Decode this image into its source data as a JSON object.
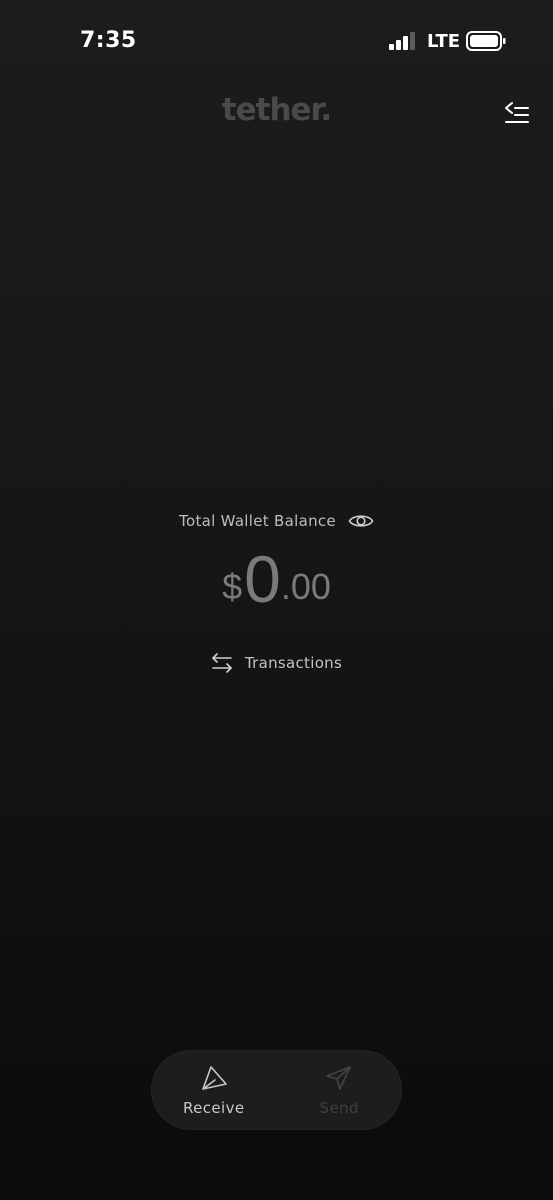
{
  "status_bar": {
    "time": "7:35",
    "network": "LTE",
    "signal_icon": "signal-bars-icon",
    "battery_icon": "battery-icon"
  },
  "header": {
    "brand": "tether",
    "brand_dot": ".",
    "menu_icon": "menu-collapse-icon",
    "brand_color": "#4a4a4a"
  },
  "balance": {
    "label": "Total Wallet Balance",
    "visibility_icon": "eye-icon",
    "currency": "$",
    "whole": "0",
    "fraction": ".00",
    "amount_color": "#7a7a7a"
  },
  "transactions": {
    "label": "Transactions",
    "icon": "swap-arrows-icon"
  },
  "actions": {
    "receive_label": "Receive",
    "send_label": "Send",
    "receive_icon": "receive-icon",
    "send_icon": "send-icon"
  }
}
